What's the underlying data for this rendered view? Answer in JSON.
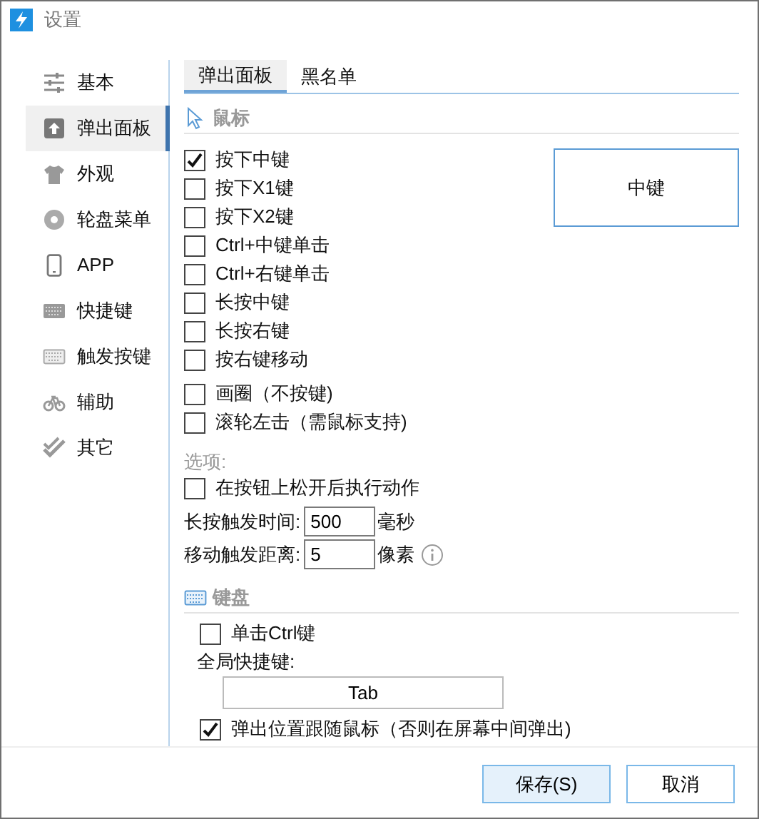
{
  "window": {
    "title": "设置"
  },
  "sidebar": {
    "items": [
      {
        "label": "基本",
        "selected": false
      },
      {
        "label": "弹出面板",
        "selected": true
      },
      {
        "label": "外观",
        "selected": false
      },
      {
        "label": "轮盘菜单",
        "selected": false
      },
      {
        "label": "APP",
        "selected": false
      },
      {
        "label": "快捷键",
        "selected": false
      },
      {
        "label": "触发按键",
        "selected": false
      },
      {
        "label": "辅助",
        "selected": false
      },
      {
        "label": "其它",
        "selected": false
      }
    ]
  },
  "tabs": [
    {
      "label": "弹出面板",
      "selected": true
    },
    {
      "label": "黑名单",
      "selected": false
    }
  ],
  "mouse": {
    "title": "鼠标",
    "options": [
      {
        "label": "按下中键",
        "checked": true
      },
      {
        "label": "按下X1键",
        "checked": false
      },
      {
        "label": "按下X2键",
        "checked": false
      },
      {
        "label": "Ctrl+中键单击",
        "checked": false
      },
      {
        "label": "Ctrl+右键单击",
        "checked": false
      },
      {
        "label": "长按中键",
        "checked": false
      },
      {
        "label": "长按右键",
        "checked": false
      },
      {
        "label": "按右键移动",
        "checked": false
      }
    ],
    "extra_options": [
      {
        "label": "画圈（不按键)",
        "checked": false
      },
      {
        "label": "滚轮左击（需鼠标支持)",
        "checked": false
      }
    ],
    "preview": "中键"
  },
  "settings": {
    "title": "选项:",
    "release_action": {
      "label": "在按钮上松开后执行动作",
      "checked": false
    },
    "long_press": {
      "label": "长按触发时间:",
      "value": "500",
      "unit": "毫秒"
    },
    "move_distance": {
      "label": "移动触发距离:",
      "value": "5",
      "unit": "像素"
    }
  },
  "keyboard": {
    "title": "键盘",
    "single_ctrl": {
      "label": "单击Ctrl键",
      "checked": false
    },
    "hotkey": {
      "label": "全局快捷键:",
      "value": "Tab"
    },
    "follow_mouse": {
      "label": "弹出位置跟随鼠标（否则在屏幕中间弹出)",
      "checked": true
    }
  },
  "buttons": [
    {
      "label": "保存(S)",
      "kind": "primary"
    },
    {
      "label": "取消",
      "kind": "default"
    }
  ]
}
